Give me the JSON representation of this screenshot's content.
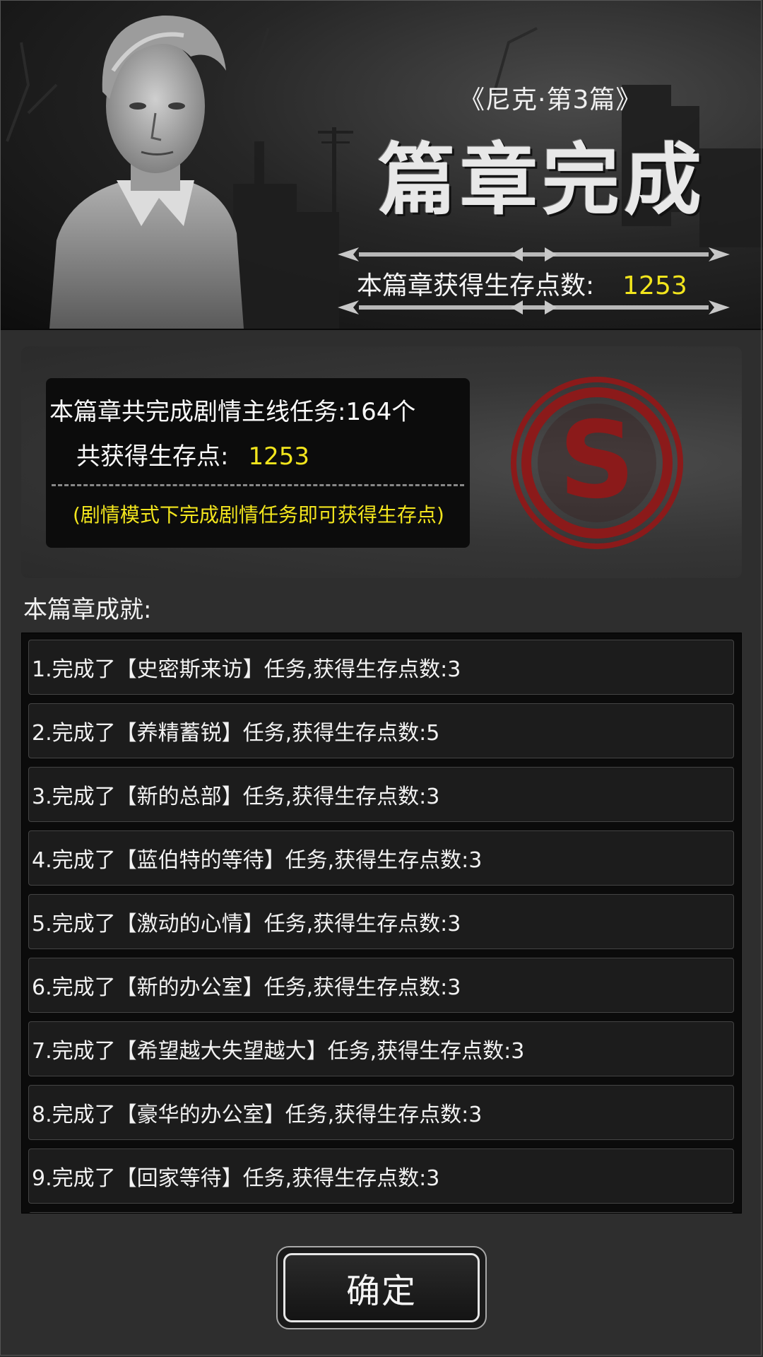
{
  "header": {
    "chapter_name": "《尼克·第3篇》",
    "title": "篇章完成",
    "points_label": "本篇章获得生存点数:",
    "points_value": "1253"
  },
  "summary": {
    "missions_text": "本篇章共完成剧情主线任务:164个",
    "points_label": "共获得生存点:",
    "points_value": "1253",
    "note": "(剧情模式下完成剧情任务即可获得生存点)",
    "emblem_letter": "S"
  },
  "achievements": {
    "title": "本篇章成就:",
    "items": [
      "1.完成了【史密斯来访】任务,获得生存点数:3",
      "2.完成了【养精蓄锐】任务,获得生存点数:5",
      "3.完成了【新的总部】任务,获得生存点数:3",
      "4.完成了【蓝伯特的等待】任务,获得生存点数:3",
      "5.完成了【激动的心情】任务,获得生存点数:3",
      "6.完成了【新的办公室】任务,获得生存点数:3",
      "7.完成了【希望越大失望越大】任务,获得生存点数:3",
      "8.完成了【豪华的办公室】任务,获得生存点数:3",
      "9.完成了【回家等待】任务,获得生存点数:3"
    ]
  },
  "confirm_label": "确定",
  "colors": {
    "highlight": "#f2e51d",
    "background": "#2e2e2e",
    "emblem": "#8b1a1a"
  }
}
